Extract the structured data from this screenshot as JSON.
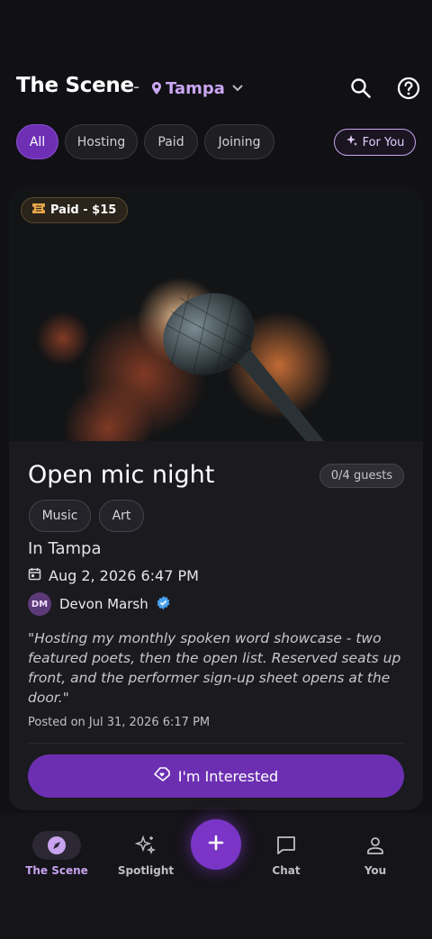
{
  "header": {
    "app_title": "The Scene",
    "separator": "-",
    "location": "Tampa"
  },
  "filters": {
    "chips": [
      {
        "label": "All",
        "active": true
      },
      {
        "label": "Hosting",
        "active": false
      },
      {
        "label": "Paid",
        "active": false
      },
      {
        "label": "Joining",
        "active": false
      }
    ],
    "for_you": "For You"
  },
  "event": {
    "badge": "Paid - $15",
    "title": "Open mic night",
    "guests": "0/4 guests",
    "tags": [
      "Music",
      "Art"
    ],
    "location": "In Tampa",
    "datetime": "Aug 2, 2026 6:47 PM",
    "host_initials": "DM",
    "host_name": "Devon Marsh",
    "host_verified": true,
    "quote": "\"Hosting my monthly spoken word showcase - two featured poets, then the open list. Reserved seats up front, and the performer sign-up sheet opens at the door.\"",
    "posted": "Posted on Jul 31, 2026 6:17 PM",
    "cta": "I'm Interested"
  },
  "nav": {
    "items": [
      {
        "label": "The Scene",
        "icon": "compass-icon",
        "active": true
      },
      {
        "label": "Spotlight",
        "icon": "sparkles-icon",
        "active": false
      },
      {
        "label": "Chat",
        "icon": "chat-icon",
        "active": false
      },
      {
        "label": "You",
        "icon": "person-icon",
        "active": false
      }
    ],
    "fab_icon": "plus-icon"
  },
  "colors": {
    "accent": "#6f2fb5",
    "accent_light": "#c8a3f0",
    "background": "#111014",
    "card": "#1b1a1f"
  }
}
